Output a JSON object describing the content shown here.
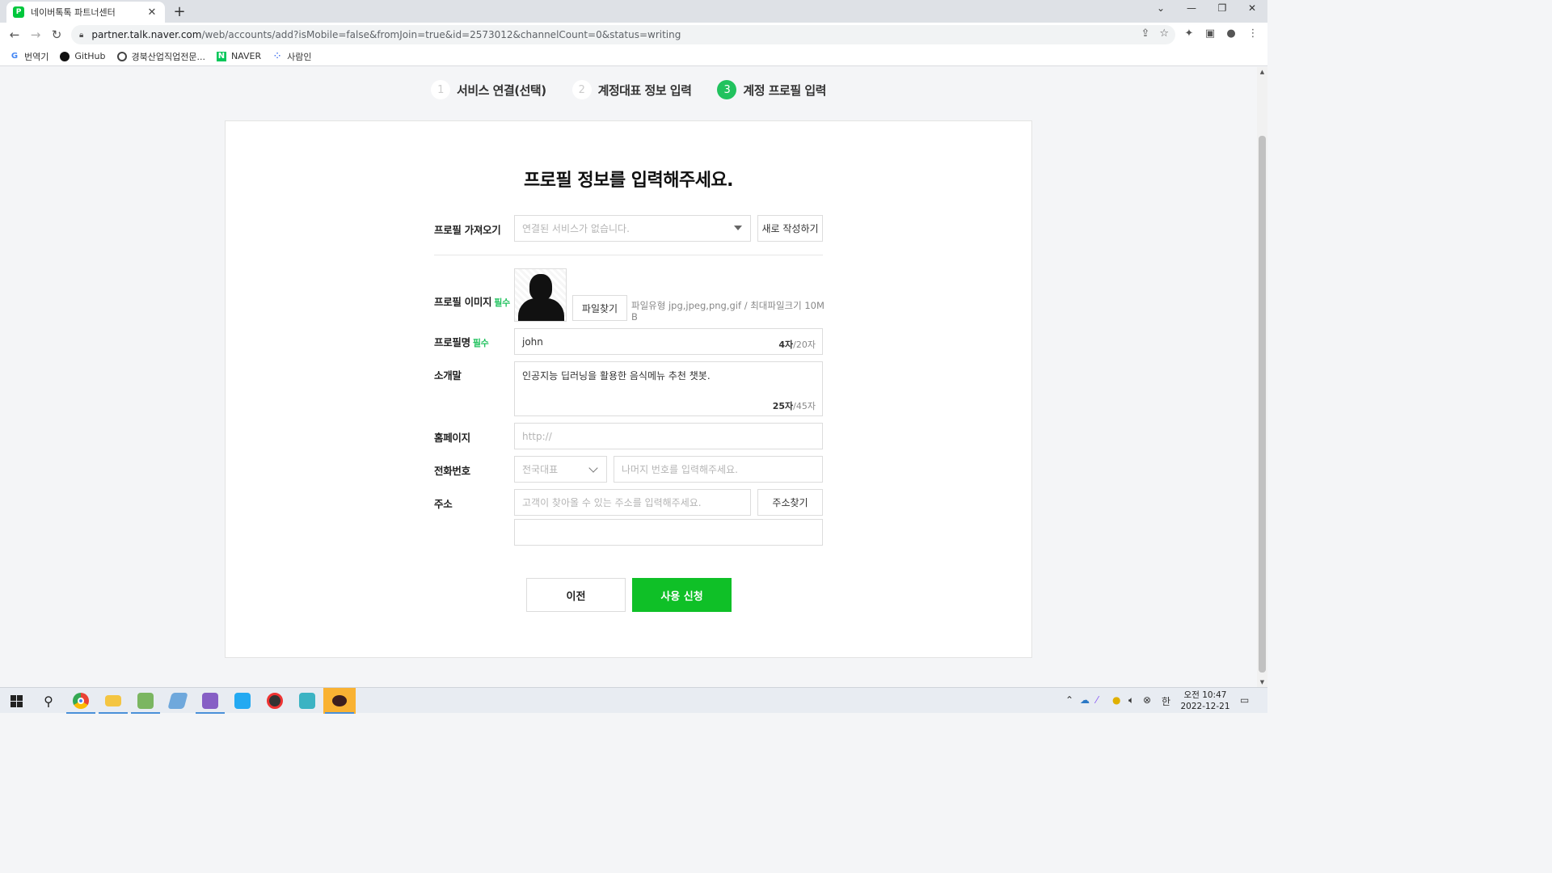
{
  "browser": {
    "tab_title": "네이버톡톡 파트너센터",
    "tab_favicon_letter": "P",
    "url_host": "partner.talk.naver.com",
    "url_path": "/web/accounts/add?isMobile=false&fromJoin=true&id=2573012&channelCount=0&status=writing",
    "bookmarks": [
      {
        "label": "번역기",
        "icon": "google-icon"
      },
      {
        "label": "GitHub",
        "icon": "github-icon"
      },
      {
        "label": "경북산업직업전문...",
        "icon": "globe-icon"
      },
      {
        "label": "NAVER",
        "icon": "naver-icon"
      },
      {
        "label": "사람인",
        "icon": "saramin-icon"
      }
    ]
  },
  "steps": [
    {
      "num": "1",
      "label": "서비스 연결(선택)",
      "active": false
    },
    {
      "num": "2",
      "label": "계정대표 정보 입력",
      "active": false
    },
    {
      "num": "3",
      "label": "계정 프로필 입력",
      "active": true
    }
  ],
  "form": {
    "heading": "프로필 정보를 입력해주세요.",
    "import": {
      "label": "프로필 가져오기",
      "select_placeholder": "연결된 서비스가 없습니다.",
      "new_button": "새로 작성하기"
    },
    "image": {
      "label": "프로필 이미지",
      "required": "필수",
      "file_button": "파일찾기",
      "hint": "파일유형 jpg,jpeg,png,gif / 최대파일크기 10MB"
    },
    "name": {
      "label": "프로필명",
      "required": "필수",
      "value": "john",
      "count": "4자",
      "max": "/20자"
    },
    "intro": {
      "label": "소개말",
      "value": "인공지능 딥러닝을 활용한 음식메뉴 추천 챗봇.",
      "count": "25자",
      "max": "/45자"
    },
    "homepage": {
      "label": "홈페이지",
      "placeholder": "http://"
    },
    "phone": {
      "label": "전화번호",
      "select_value": "전국대표",
      "placeholder": "나머지 번호를 입력해주세요."
    },
    "address": {
      "label": "주소",
      "placeholder": "고객이 찾아올 수 있는 주소를 입력해주세요.",
      "search_button": "주소찾기",
      "detail_value": ""
    },
    "prev_button": "이전",
    "submit_button": "사용 신청"
  },
  "taskbar": {
    "time": "오전 10:47",
    "date": "2022-12-21",
    "ime": "한"
  },
  "colors": {
    "accent_green": "#0fc027",
    "step_active": "#21c25e"
  }
}
